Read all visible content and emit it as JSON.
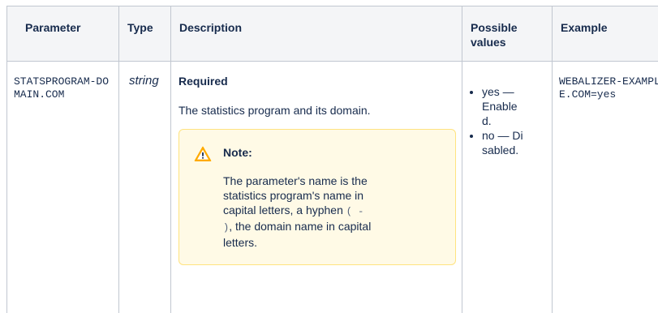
{
  "headers": {
    "parameter": "Parameter",
    "type": "Type",
    "description": "Description",
    "possible_values": "Possible values",
    "example": "Example"
  },
  "row": {
    "parameter": "STATSPROGRAM-DOMAIN.COM",
    "type": "string",
    "required": "Required",
    "description": "The statistics program and its domain.",
    "note": {
      "title": "Note:",
      "text_before": "The parameter's name is the statistics program's name in capital letters, a hyphen ",
      "code": "( - )",
      "text_after": ", the domain name in capital letters."
    },
    "values": [
      "yes — Enabled.",
      "no — Disabled."
    ],
    "example": "WEBALIZER-EXAMPLE.COM=yes"
  },
  "colors": {
    "border": "#c1c7d0",
    "header_bg": "#f4f5f7",
    "note_bg": "#fffae6",
    "note_border": "#ffe380",
    "warning_icon": "#ffab00"
  },
  "icons": {
    "note": "warning-icon"
  }
}
